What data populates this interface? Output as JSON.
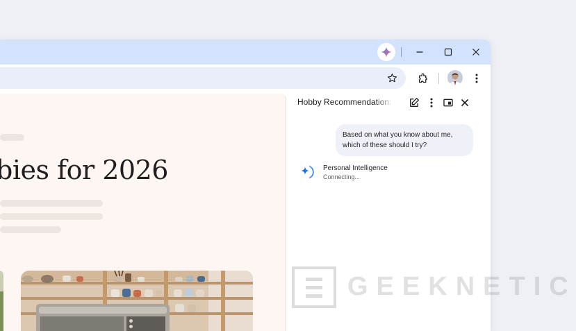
{
  "sidepanel": {
    "title": "Hobby Recommendation: Ba",
    "user_message": "Based on what you know about me, which of these should I try?",
    "assistant": {
      "name": "Personal Intelligence",
      "status": "Connecting..."
    }
  },
  "page": {
    "headline": "bies for 2026"
  },
  "watermark": {
    "text": "GEEKNETIC"
  },
  "colors": {
    "titlebar": "#d3e3fd",
    "omnibox": "#e9eefa",
    "page_bg": "#fdf6f3",
    "bubble": "#eef2f8",
    "accent": "#1a73e8"
  },
  "icons": {
    "titlebar": [
      "gemini-icon",
      "minimize-icon",
      "maximize-icon",
      "close-icon"
    ],
    "toolbar": [
      "star-icon",
      "extensions-icon",
      "avatar",
      "more-vert-icon"
    ],
    "panel": [
      "edit-icon",
      "more-vert-icon",
      "open-in-tab-icon",
      "close-icon"
    ]
  }
}
